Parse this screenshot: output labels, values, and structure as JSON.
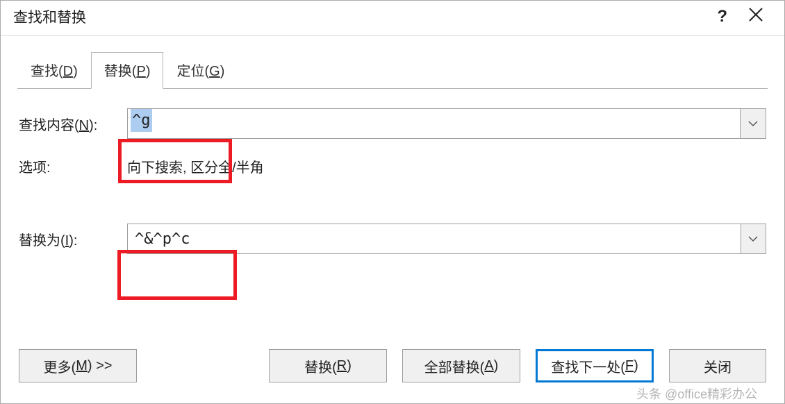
{
  "dialog": {
    "title": "查找和替换"
  },
  "tabs": {
    "find": {
      "label": "查找(",
      "hotkey": "D",
      "suffix": ")"
    },
    "replace": {
      "label": "替换(",
      "hotkey": "P",
      "suffix": ")"
    },
    "goto": {
      "label": "定位(",
      "hotkey": "G",
      "suffix": ")"
    }
  },
  "fields": {
    "find_label": {
      "text": "查找内容(",
      "hotkey": "N",
      "suffix": "):"
    },
    "find_value": "^g",
    "options_label": "选项:",
    "options_value": "向下搜索, 区分全/半角",
    "replace_label": {
      "text": "替换为(",
      "hotkey": "I",
      "suffix": "):"
    },
    "replace_value": "^&^p^c"
  },
  "buttons": {
    "more": {
      "text": "更多(",
      "hotkey": "M",
      "suffix": ") >>"
    },
    "replace": {
      "text": "替换(",
      "hotkey": "R",
      "suffix": ")"
    },
    "replace_all": {
      "text": "全部替换(",
      "hotkey": "A",
      "suffix": ")"
    },
    "find_next": {
      "text": "查找下一处(",
      "hotkey": "F",
      "suffix": ")"
    },
    "close": "关闭"
  },
  "watermark": "头条 @office精彩办公"
}
